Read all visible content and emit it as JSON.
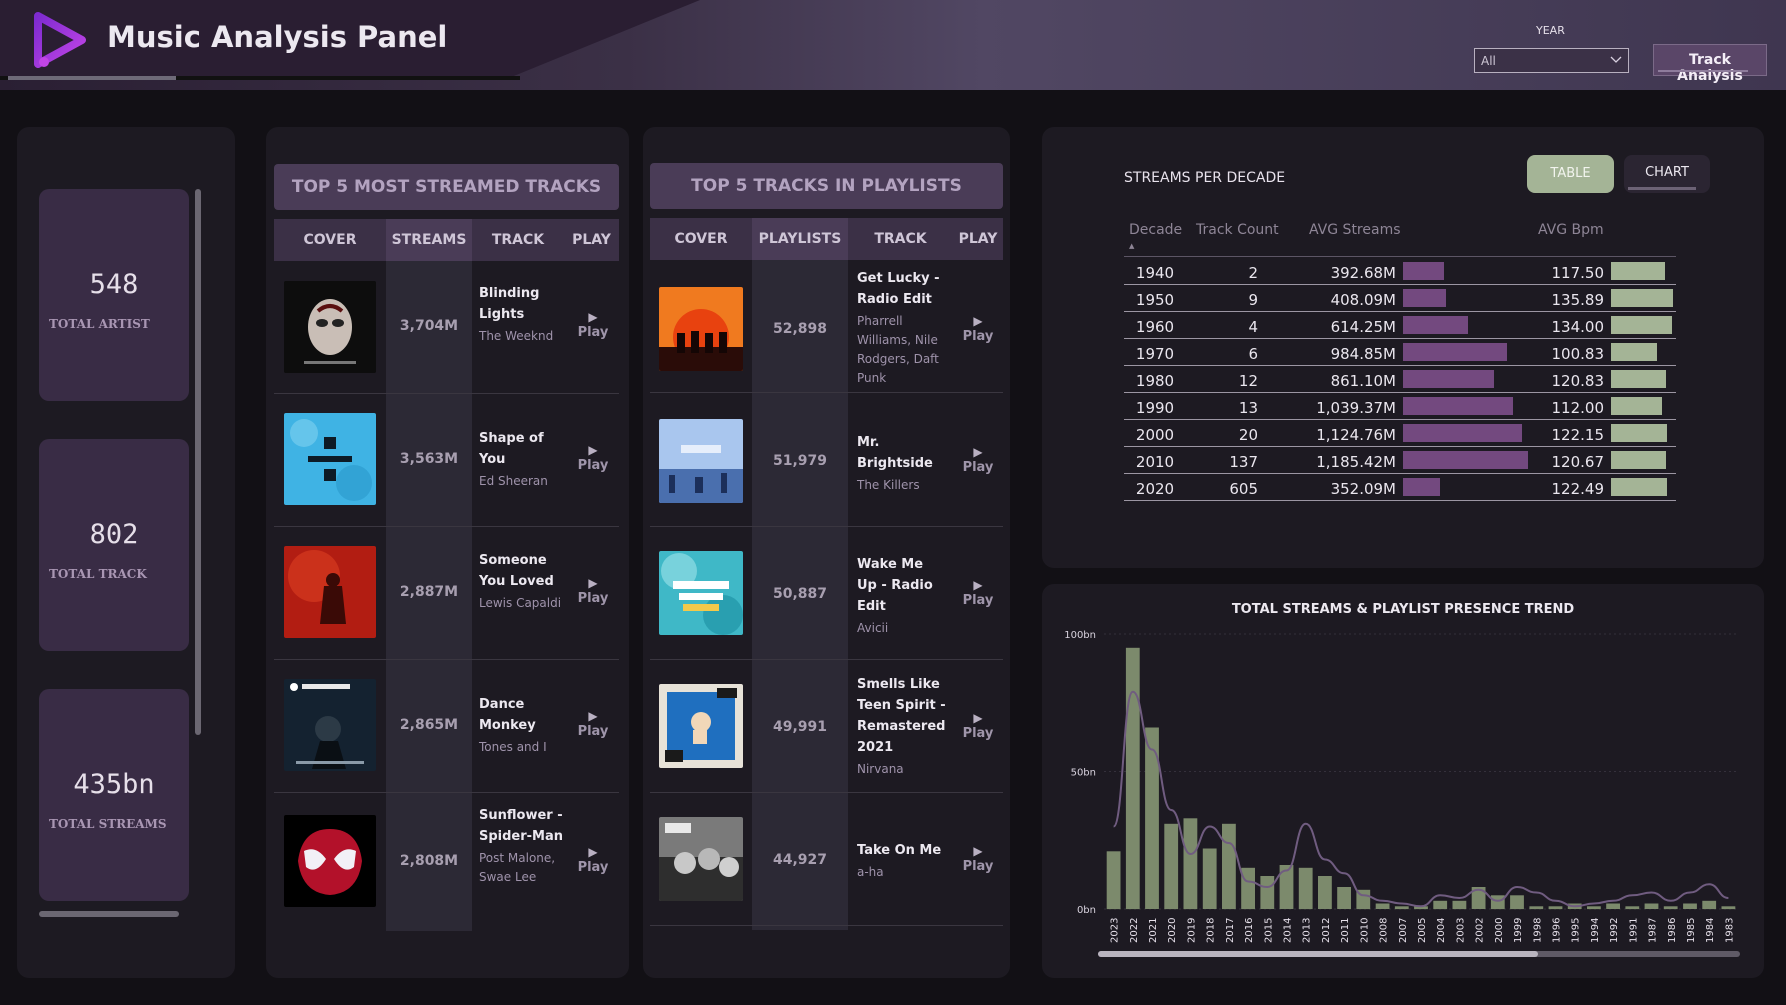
{
  "header": {
    "title": "Music Analysis Panel",
    "year_label": "YEAR",
    "year_selected": "All",
    "track_analysis_label": "Track Analysis"
  },
  "kpis": [
    {
      "value": "548",
      "label": "TOTAL ARTIST"
    },
    {
      "value": "802",
      "label": "TOTAL TRACK"
    },
    {
      "value": "435bn",
      "label": "TOTAL STREAMS"
    }
  ],
  "streamed": {
    "title": "TOP 5 MOST STREAMED TRACKS",
    "columns": [
      "COVER",
      "STREAMS",
      "TRACK",
      "PLAY"
    ],
    "rows": [
      {
        "value": "3,704M",
        "track": "Blinding Lights",
        "artist": "The Weeknd",
        "play": "Play"
      },
      {
        "value": "3,563M",
        "track": "Shape of You",
        "artist": "Ed Sheeran",
        "play": "Play"
      },
      {
        "value": "2,887M",
        "track": "Someone You Loved",
        "artist": "Lewis Capaldi",
        "play": "Play"
      },
      {
        "value": "2,865M",
        "track": "Dance Monkey",
        "artist": "Tones and I",
        "play": "Play"
      },
      {
        "value": "2,808M",
        "track": "Sunflower - Spider-Man",
        "artist": "Post Malone, Swae Lee",
        "play": "Play"
      }
    ]
  },
  "playlists": {
    "title": "TOP 5 TRACKS IN PLAYLISTS",
    "columns": [
      "COVER",
      "PLAYLISTS",
      "TRACK",
      "PLAY"
    ],
    "rows": [
      {
        "value": "52,898",
        "track": "Get Lucky - Radio Edit",
        "artist": "Pharrell Williams, Nile Rodgers, Daft Punk",
        "play": "Play"
      },
      {
        "value": "51,979",
        "track": "Mr. Brightside",
        "artist": "The Killers",
        "play": "Play"
      },
      {
        "value": "50,887",
        "track": "Wake Me Up - Radio Edit",
        "artist": "Avicii",
        "play": "Play"
      },
      {
        "value": "49,991",
        "track": "Smells Like Teen Spirit - Remastered 2021",
        "artist": "Nirvana",
        "play": "Play"
      },
      {
        "value": "44,927",
        "track": "Take On Me",
        "artist": "a-ha",
        "play": "Play"
      }
    ]
  },
  "decade_table": {
    "title": "STREAMS  PER DECADE",
    "toggle_table": "TABLE",
    "toggle_chart": "CHART",
    "headers": [
      "Decade",
      "Track Count",
      "AVG Streams",
      "AVG Bpm"
    ],
    "rows": [
      {
        "decade": "1940",
        "count": "2",
        "avg_streams": "392.68M",
        "avg_bpm": "117.50",
        "streams_m": 392.68,
        "bpm": 117.5
      },
      {
        "decade": "1950",
        "count": "9",
        "avg_streams": "408.09M",
        "avg_bpm": "135.89",
        "streams_m": 408.09,
        "bpm": 135.89
      },
      {
        "decade": "1960",
        "count": "4",
        "avg_streams": "614.25M",
        "avg_bpm": "134.00",
        "streams_m": 614.25,
        "bpm": 134.0
      },
      {
        "decade": "1970",
        "count": "6",
        "avg_streams": "984.85M",
        "avg_bpm": "100.83",
        "streams_m": 984.85,
        "bpm": 100.83
      },
      {
        "decade": "1980",
        "count": "12",
        "avg_streams": "861.10M",
        "avg_bpm": "120.83",
        "streams_m": 861.1,
        "bpm": 120.83
      },
      {
        "decade": "1990",
        "count": "13",
        "avg_streams": "1,039.37M",
        "avg_bpm": "112.00",
        "streams_m": 1039.37,
        "bpm": 112.0
      },
      {
        "decade": "2000",
        "count": "20",
        "avg_streams": "1,124.76M",
        "avg_bpm": "122.15",
        "streams_m": 1124.76,
        "bpm": 122.15
      },
      {
        "decade": "2010",
        "count": "137",
        "avg_streams": "1,185.42M",
        "avg_bpm": "120.67",
        "streams_m": 1185.42,
        "bpm": 120.67
      },
      {
        "decade": "2020",
        "count": "605",
        "avg_streams": "352.09M",
        "avg_bpm": "122.49",
        "streams_m": 352.09,
        "bpm": 122.49
      }
    ]
  },
  "chart_data": {
    "type": "bar",
    "title": "TOTAL STREAMS & PLAYLIST PRESENCE TREND",
    "y_ticks": [
      "100bn",
      "50bn",
      "0bn"
    ],
    "ylim": [
      0,
      100
    ],
    "categories": [
      "2023",
      "2022",
      "2021",
      "2020",
      "2019",
      "2018",
      "2017",
      "2016",
      "2015",
      "2014",
      "2013",
      "2012",
      "2011",
      "2010",
      "2008",
      "2007",
      "2005",
      "2004",
      "2003",
      "2002",
      "2000",
      "1999",
      "1998",
      "1996",
      "1995",
      "1994",
      "1992",
      "1991",
      "1987",
      "1986",
      "1985",
      "1984",
      "1983"
    ],
    "series": [
      {
        "type": "bar",
        "color": "#7c8a6c",
        "values": [
          21,
          95,
          66,
          31,
          33,
          22,
          31,
          15,
          12,
          16,
          15,
          12,
          8,
          7,
          2,
          1,
          1,
          3,
          3,
          8,
          5,
          5,
          1,
          1,
          2,
          1,
          2,
          1,
          2,
          1,
          2,
          3,
          1
        ]
      },
      {
        "type": "line",
        "color": "#705c80",
        "values": [
          30,
          79,
          58,
          36,
          20,
          30,
          24,
          10,
          8,
          14,
          31,
          18,
          13,
          5,
          3,
          2,
          1,
          5,
          4,
          7,
          3,
          8,
          6,
          3,
          1,
          2,
          3,
          5,
          6,
          3,
          6,
          9,
          4
        ]
      }
    ]
  },
  "colors": {
    "accent_purple": "#73497f",
    "accent_green": "#a4b496",
    "panel_bg": "#1d1a22"
  }
}
